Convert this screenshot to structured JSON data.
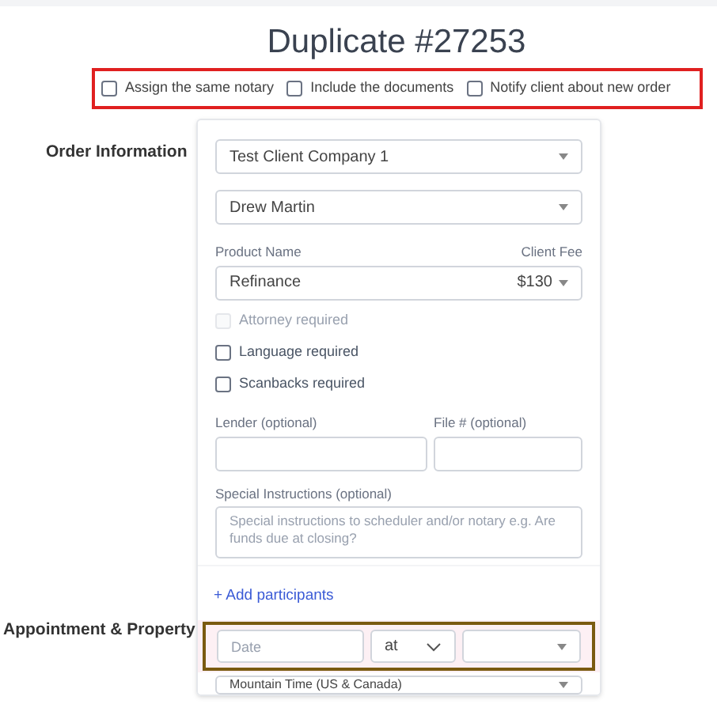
{
  "title": "Duplicate #27253",
  "options": [
    {
      "label": "Assign the same notary",
      "checked": false
    },
    {
      "label": "Include the documents",
      "checked": false
    },
    {
      "label": "Notify client about new order",
      "checked": false
    }
  ],
  "order_information": {
    "heading": "Order Information",
    "client": "Test Client Company 1",
    "contact": "Drew Martin",
    "product_label": "Product Name",
    "fee_label": "Client Fee",
    "product": "Refinance",
    "fee": "$130",
    "requirements": [
      {
        "label": "Attorney required",
        "checked": false,
        "disabled": true
      },
      {
        "label": "Language required",
        "checked": false,
        "disabled": false
      },
      {
        "label": "Scanbacks required",
        "checked": false,
        "disabled": false
      }
    ],
    "lender_label": "Lender (optional)",
    "file_label": "File # (optional)",
    "instructions_label": "Special Instructions (optional)",
    "instructions_placeholder": "Special instructions to scheduler and/or notary e.g. Are funds due at closing?",
    "add_participants": "+ Add participants"
  },
  "appointment": {
    "heading": "Appointment & Property",
    "date_placeholder": "Date",
    "at": "at",
    "timezone": "Mountain Time (US & Canada)"
  }
}
